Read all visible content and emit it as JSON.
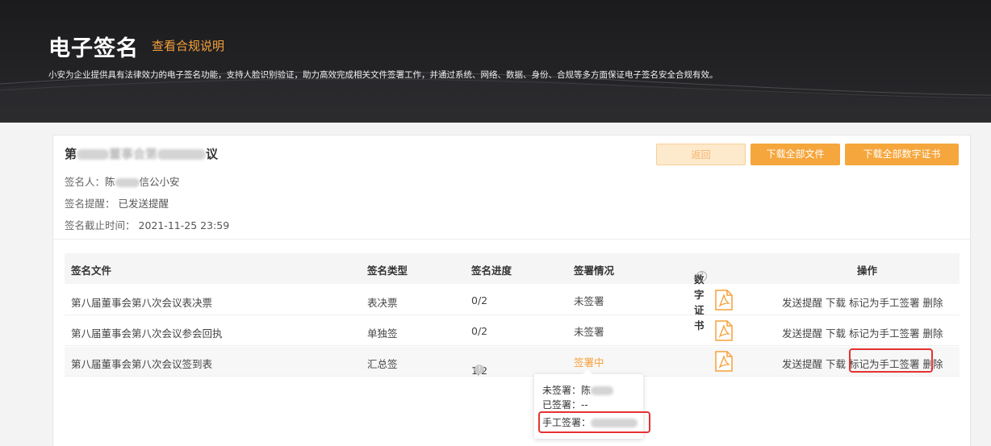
{
  "header": {
    "title": "电子签名",
    "compliance_link": "查看合规说明",
    "description": "小安为企业提供具有法律效力的电子签名功能，支持人脸识别验证，助力高效完成相关文件签署工作，并通过系统、网络、数据、身份、合规等多方面保证电子签名安全合规有效。"
  },
  "meeting": {
    "title_prefix": "第",
    "title_mid": "董事会第",
    "title_suffix": "议",
    "signer_label": "签名人：",
    "signer_prefix": "陈",
    "signer_suffix": "信公小安",
    "reminder_label": "签名提醒：",
    "reminder_value": "已发送提醒",
    "deadline_label": "签名截止时间：",
    "deadline_value": "2021-11-25 23:59"
  },
  "toolbar": {
    "back_label": "返回",
    "download_all_label": "下载全部文件",
    "download_certs_label": "下载全部数字证书"
  },
  "table": {
    "headers": {
      "file": "签名文件",
      "type": "签名类型",
      "progress": "签名进度",
      "status": "签署情况",
      "cert": "数字证书",
      "ops": "操作"
    },
    "rows": [
      {
        "file": "第八届董事会第八次会议表决票",
        "type": "表决票",
        "progress": "0/2",
        "status": "未签署"
      },
      {
        "file": "第八届董事会第八次会议参会回执",
        "type": "单独签",
        "progress": "0/2",
        "status": "未签署"
      },
      {
        "file": "第八届董事会第八次会议签到表",
        "type": "汇总签",
        "progress": "1/2",
        "status": "签署中"
      }
    ],
    "ops": {
      "remind": "发送提醒",
      "download": "下载",
      "mark_manual": "标记为手工签署",
      "delete": "删除"
    }
  },
  "tooltip": {
    "unsigned_label": "未签署：",
    "unsigned_value": "陈",
    "signed_label": "已签署：",
    "signed_value": "--",
    "manual_label": "手工签署："
  },
  "colors": {
    "accent": "#f5a63c",
    "highlight": "#e53232",
    "header_bg": "#1b1b1d"
  }
}
